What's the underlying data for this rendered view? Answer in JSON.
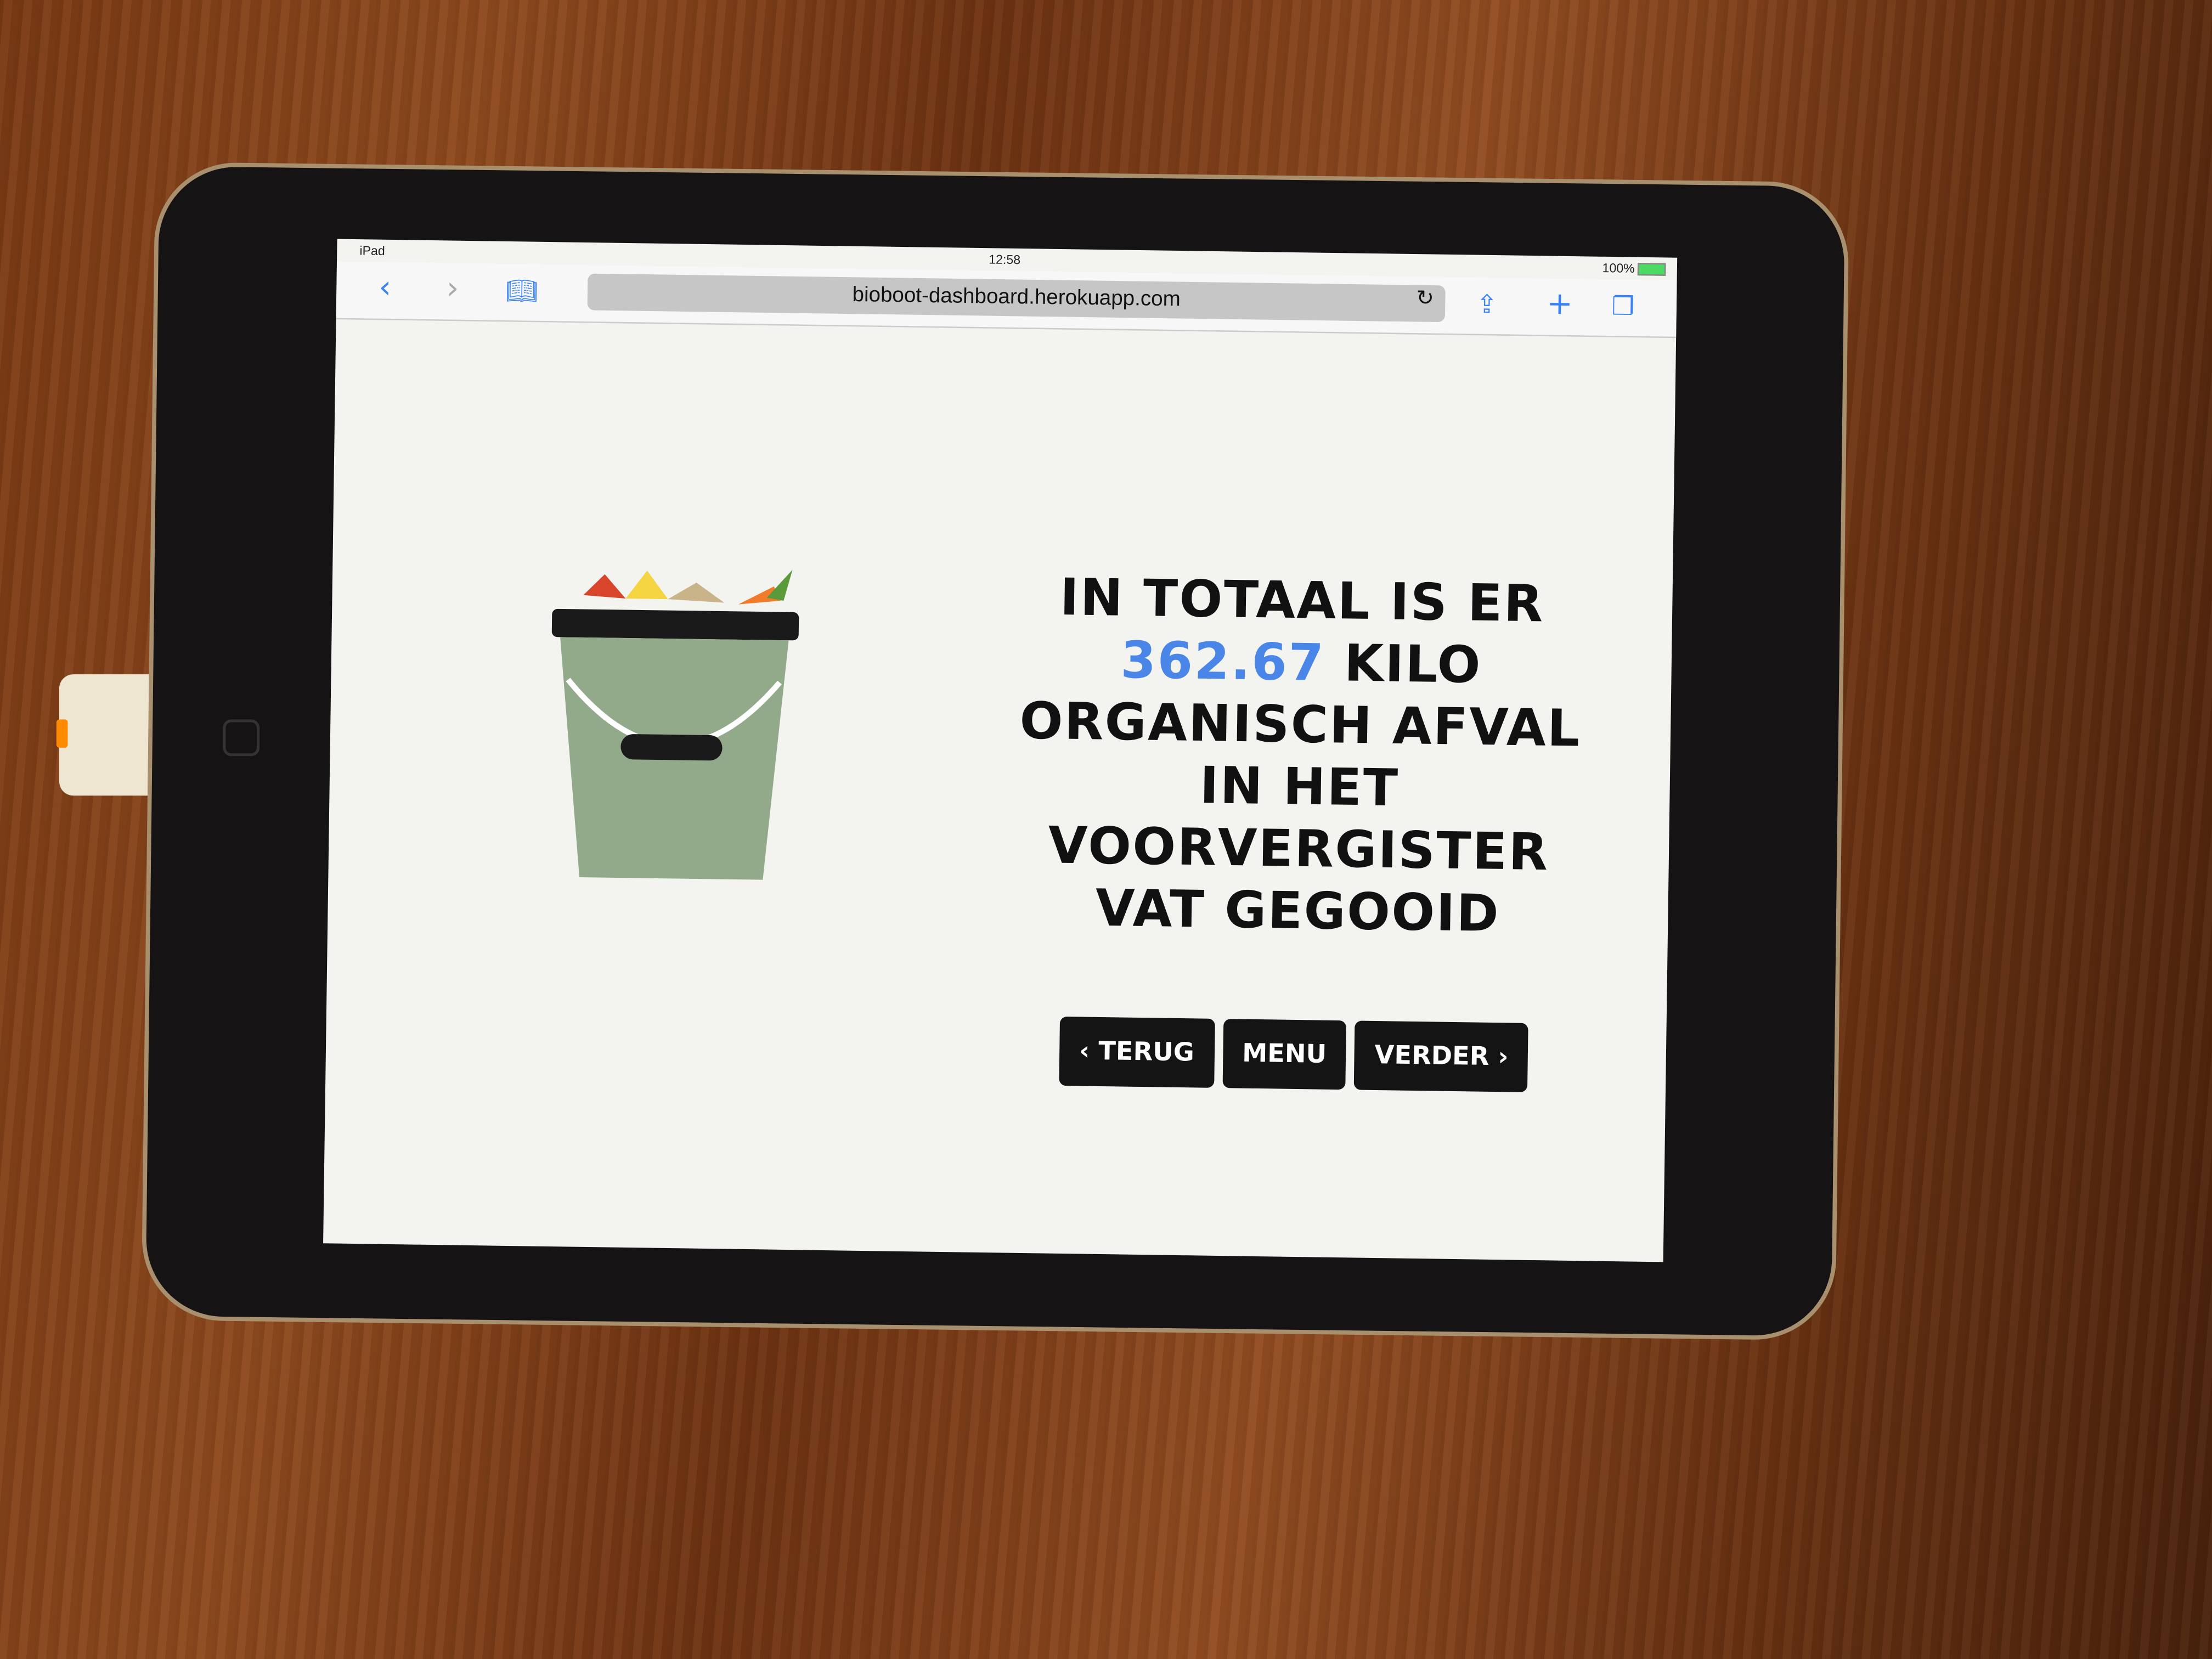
{
  "status_bar": {
    "device": "iPad",
    "time": "12:58",
    "battery": "100%"
  },
  "browser": {
    "url": "bioboot-dashboard.herokuapp.com",
    "back_icon": "chevron-left",
    "forward_icon": "chevron-right",
    "bookmarks_icon": "book",
    "reload_icon": "reload",
    "share_icon": "share",
    "new_tab_icon": "plus",
    "tabs_icon": "tabs",
    "accent": "#3b82f6"
  },
  "page": {
    "headline_before": "IN TOTAAL IS ER",
    "amount": "362.67",
    "headline_after": "KILO ORGANISCH AFVAL IN HET VOORVERGISTER VAT GEGOOID",
    "amount_color": "#4a86e8",
    "buttons": {
      "back": "‹ TERUG",
      "menu": "MENU",
      "next": "VERDER ›"
    },
    "bucket_color": "#92a98a"
  }
}
